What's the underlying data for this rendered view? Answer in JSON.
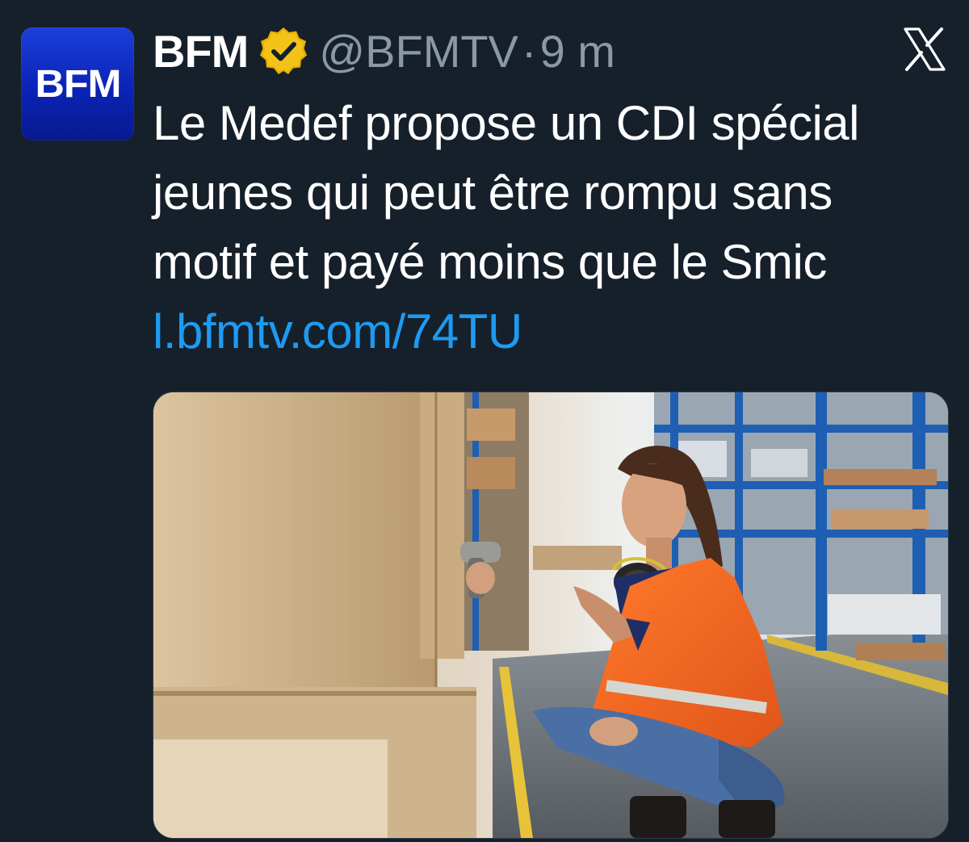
{
  "author": {
    "avatar_text": "BFM",
    "name": "BFM",
    "handle": "@BFMTV",
    "separator": "·",
    "time": "9 m",
    "verified_icon": "verified-gold-badge-icon"
  },
  "tweet": {
    "lines": [
      "Le Medef propose un CDI spécial",
      "jeunes qui peut être rompu sans",
      "motif et payé moins que le Smic"
    ],
    "link": "l.bfmtv.com/74TU"
  },
  "colors": {
    "background": "#16202b",
    "text": "#ffffff",
    "secondary_text": "#8b98a5",
    "link": "#1d9bf0",
    "verified_badge": "#e8b100",
    "avatar": "#0b23b6"
  },
  "platform_icon": "x-logo-icon"
}
